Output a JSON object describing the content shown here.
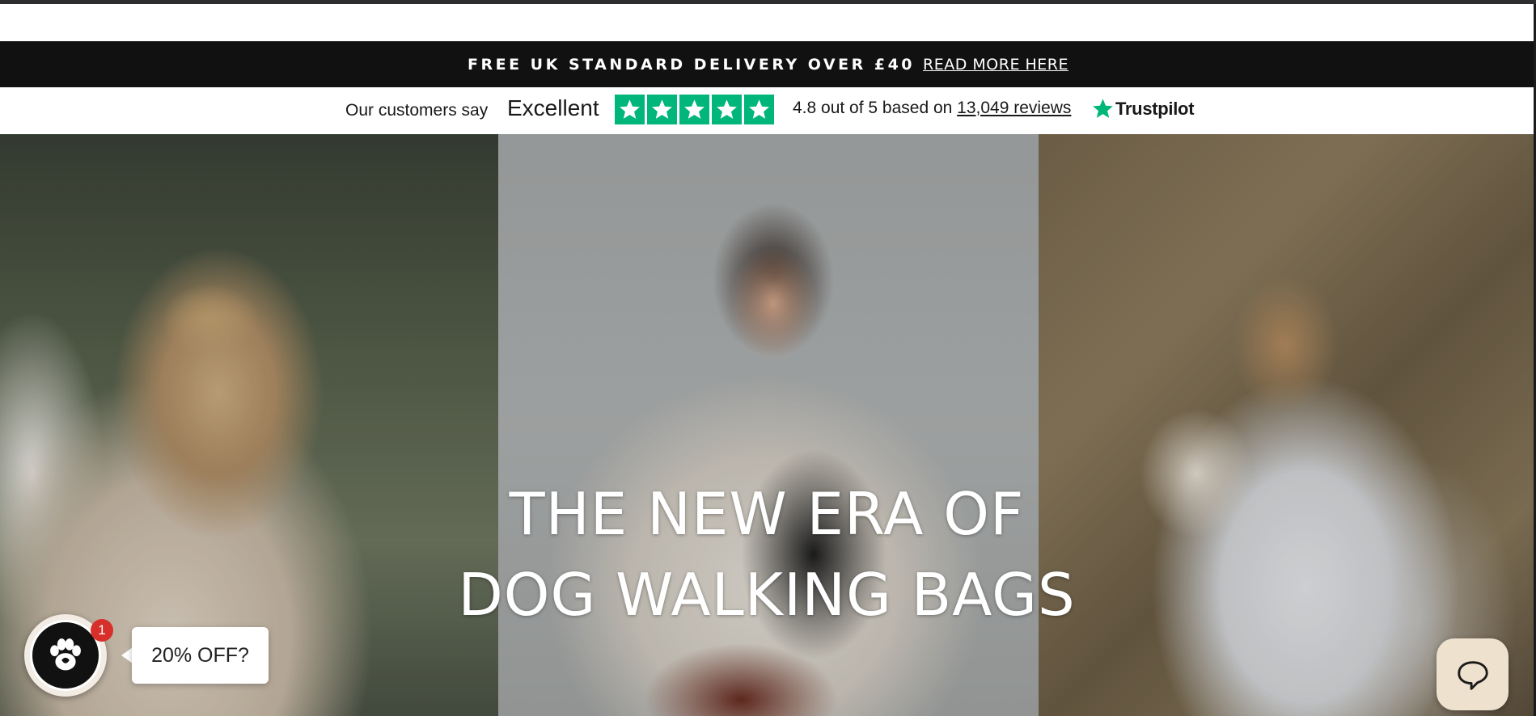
{
  "promo": {
    "text": "FREE UK STANDARD DELIVERY OVER £40",
    "link": "READ MORE HERE"
  },
  "trustpilot": {
    "customers_say": "Our customers say",
    "rating_word": "Excellent",
    "stars": 5,
    "summary_prefix": "4.8 out of 5 based on",
    "reviews_link": "13,049 reviews",
    "brand": "Trustpilot",
    "brand_color": "#00b67a"
  },
  "hero": {
    "title_line_1": "THE NEW ERA OF",
    "title_line_2": "DOG WALKING BAGS"
  },
  "widgets": {
    "discount_badge_count": "1",
    "discount_label": "20% OFF?",
    "launcher_icon": "paw-icon",
    "chat_icon": "chat-bubble-icon"
  },
  "colors": {
    "promo_background": "#111111",
    "badge": "#d7302b",
    "chat_button": "#eee1cd"
  }
}
